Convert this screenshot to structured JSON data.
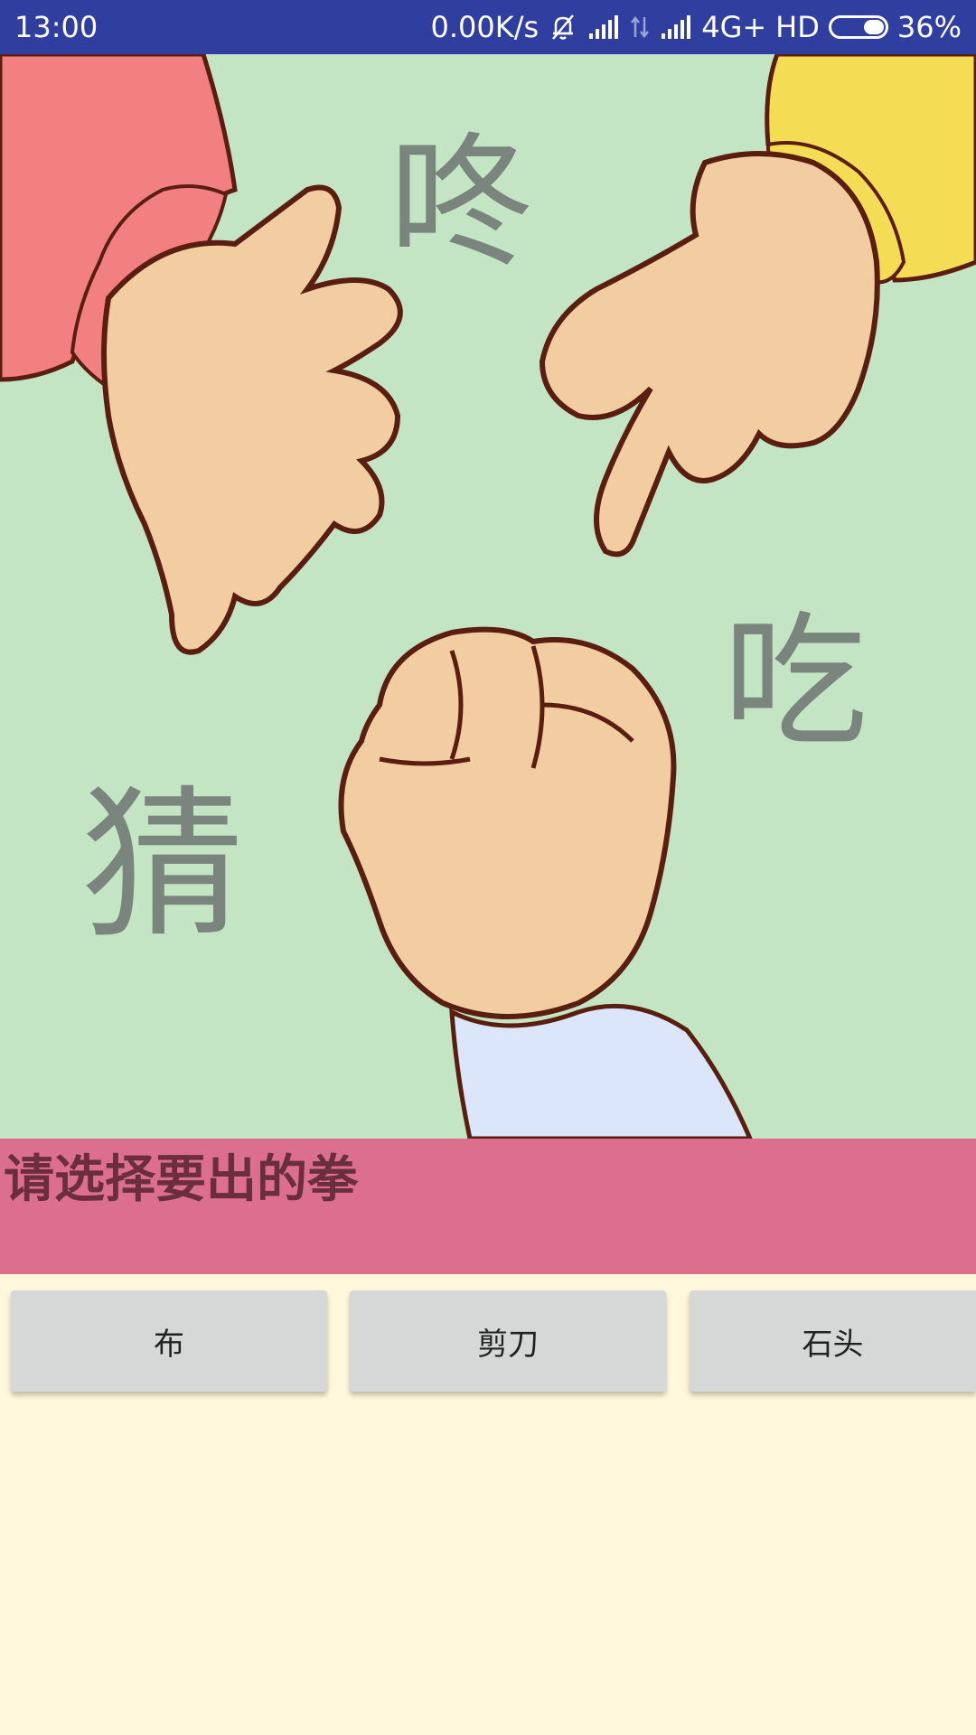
{
  "status_bar": {
    "time": "13:00",
    "net_speed": "0.00K/s",
    "network": "4G+",
    "hd": "HD",
    "battery": "36%",
    "icons": [
      "bell-off-icon",
      "signal-icon",
      "data-arrows-icon",
      "signal-icon",
      "battery-icon"
    ]
  },
  "illustration": {
    "chars": {
      "dong": "咚",
      "chi": "吃",
      "cai": "猜"
    },
    "background_color": "#C3E5C3"
  },
  "prompt": {
    "text": "请选择要出的拳",
    "background_color": "#DC6E8E"
  },
  "buttons": {
    "cloth": "布",
    "scissors": "剪刀",
    "stone": "石头"
  }
}
